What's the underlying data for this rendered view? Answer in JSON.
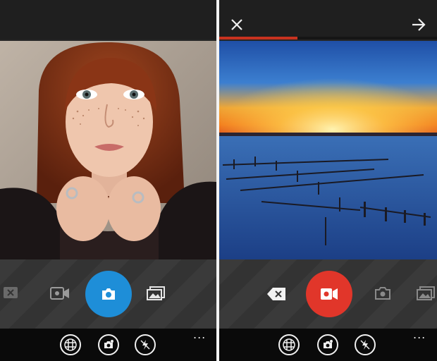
{
  "screens": [
    {
      "mode": "photo",
      "controls": [
        "delete-icon",
        "video-camera-icon",
        "camera-icon",
        "gallery-icon"
      ],
      "bottom_bar": [
        "grid-icon",
        "effects-icon",
        "flash-off-icon"
      ],
      "more_label": "..."
    },
    {
      "mode": "video",
      "recording_progress": 0.36,
      "controls": [
        "backspace-icon",
        "video-record-icon",
        "camera-icon",
        "gallery-icon"
      ],
      "bottom_bar": [
        "grid-icon",
        "effects-icon",
        "flash-off-icon"
      ],
      "more_label": "..."
    }
  ],
  "colors": {
    "photo_shutter": "#1e8ed8",
    "video_shutter": "#e1362a",
    "progress": "#c8321f",
    "panel": "#333333",
    "bar": "#0a0a0a"
  }
}
